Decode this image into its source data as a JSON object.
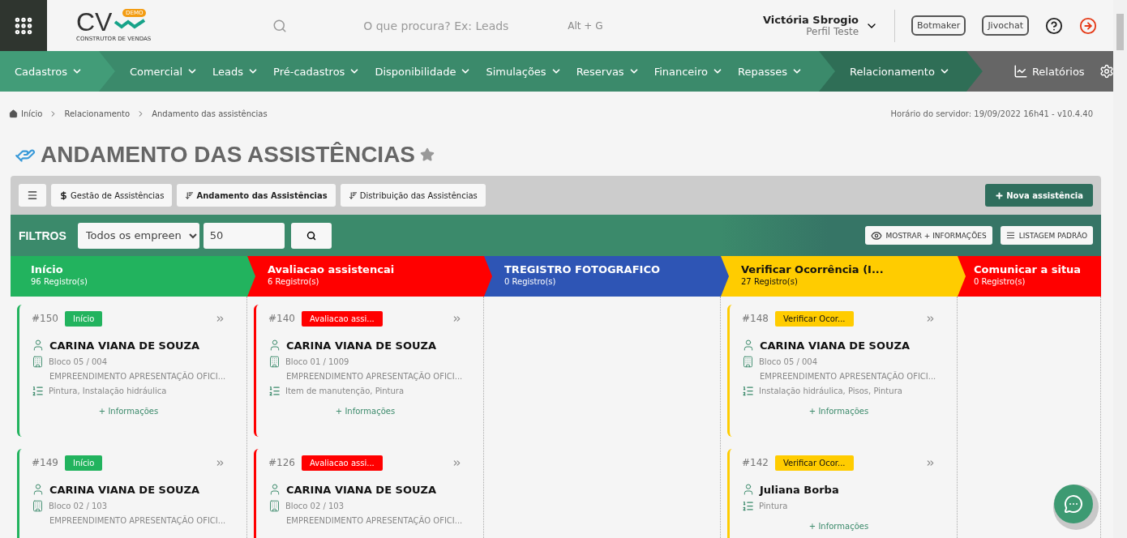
{
  "header": {
    "logo": {
      "mark": "CV",
      "badge": "DEMO",
      "tagline": "CONSTRUTOR DE VENDAS"
    },
    "search": {
      "placeholder": "O que procura? Ex: Leads",
      "shortcut": "Alt + G"
    },
    "user": {
      "name": "Victória Sbrogio",
      "profile": "Perfil Teste"
    },
    "buttons": [
      "Botmaker",
      "Jivochat"
    ]
  },
  "nav": {
    "groups": [
      {
        "color": "#429c78",
        "items": [
          {
            "kind": "menu",
            "label": "Cadastros"
          }
        ]
      },
      {
        "color": "#3b8a6b",
        "items": [
          {
            "kind": "menu",
            "label": "Comercial"
          },
          {
            "kind": "menu",
            "label": "Leads"
          },
          {
            "kind": "menu",
            "label": "Pré-cadastros"
          },
          {
            "kind": "menu",
            "label": "Disponibilidade"
          },
          {
            "kind": "menu",
            "label": "Simulações"
          },
          {
            "kind": "menu",
            "label": "Reservas"
          },
          {
            "kind": "menu",
            "label": "Financeiro"
          },
          {
            "kind": "menu",
            "label": "Repasses"
          }
        ]
      },
      {
        "color": "#2f6e56",
        "items": [
          {
            "kind": "menu",
            "label": "Relacionamento"
          }
        ]
      },
      {
        "color": "#666666",
        "items": [
          {
            "kind": "report",
            "label": "Relatórios"
          },
          {
            "kind": "settings"
          }
        ]
      }
    ]
  },
  "breadcrumb": [
    "Início",
    "Relacionamento",
    "Andamento das assistências"
  ],
  "server_time": "Horário do servidor: 19/09/2022 16h41 - v10.4.40",
  "page_title": "ANDAMENTO DAS ASSISTÊNCIAS",
  "tabs": [
    {
      "kind": "money",
      "label": "Gestão de Assistências",
      "selected": false
    },
    {
      "kind": "sort",
      "label": "Andamento das Assistências",
      "selected": true
    },
    {
      "kind": "sort",
      "label": "Distribuição das Assistências",
      "selected": false
    }
  ],
  "new_button": "Nova assistência",
  "filters": {
    "label": "FILTROS",
    "select_value": "Todos os empreen",
    "limit": "50",
    "buttons": [
      {
        "kind": "eye",
        "label": "MOSTRAR + INFORMAÇÕES"
      },
      {
        "kind": "list",
        "label": "LISTAGEM PADRÃO"
      }
    ]
  },
  "columns": [
    {
      "title": "Início",
      "count": "96 Registro(s)",
      "color": "#22b35e",
      "cards": [
        {
          "id": "#150",
          "badge": "Início",
          "name": "CARINA VIANA DE SOUZA",
          "unit": "Bloco 05 / 004",
          "project": "EMPREENDIMENTO APRESENTAÇÃO OFICI...",
          "services": "Pintura, Instalação hidráulica",
          "more": "+ Informações"
        },
        {
          "id": "#149",
          "badge": "Início",
          "name": "CARINA VIANA DE SOUZA",
          "unit": "Bloco 02 / 103",
          "project": "EMPREENDIMENTO APRESENTAÇÃO OFICI..."
        }
      ]
    },
    {
      "title": "Avaliacao assistencai",
      "count": "6 Registro(s)",
      "color": "#ff0000",
      "cards": [
        {
          "id": "#140",
          "badge": "Avaliacao assi...",
          "name": "CARINA VIANA DE SOUZA",
          "unit": "Bloco 01 / 1009",
          "project": "EMPREENDIMENTO APRESENTAÇÃO OFICI...",
          "services": "Item de manutenção, Pintura",
          "more": "+ Informações"
        },
        {
          "id": "#126",
          "badge": "Avaliacao assi...",
          "name": "CARINA VIANA DE SOUZA",
          "unit": "Bloco 02 / 103",
          "project": "EMPREENDIMENTO APRESENTAÇÃO OFICI..."
        }
      ]
    },
    {
      "title": "TREGISTRO FOTOGRAFICO",
      "count": "0 Registro(s)",
      "color": "#2e55b5"
    },
    {
      "title": "Verificar Ocorrência (I...",
      "count": "27 Registro(s)",
      "color": "#ffcc00",
      "cards": [
        {
          "id": "#148",
          "badge": "Verificar Ocor...",
          "name": "CARINA VIANA DE SOUZA",
          "unit": "Bloco 05 / 004",
          "project": "EMPREENDIMENTO APRESENTAÇÃO OFICI...",
          "services": "Instalação hidráulica, Pisos, Pintura",
          "more": "+ Informações"
        },
        {
          "id": "#142",
          "badge": "Verificar Ocor...",
          "name": "Juliana Borba",
          "services": "Pintura",
          "more": "+ Informações"
        }
      ]
    },
    {
      "title": "Comunicar a situa",
      "count": "0 Registro(s)",
      "color": "#ff0000"
    }
  ]
}
